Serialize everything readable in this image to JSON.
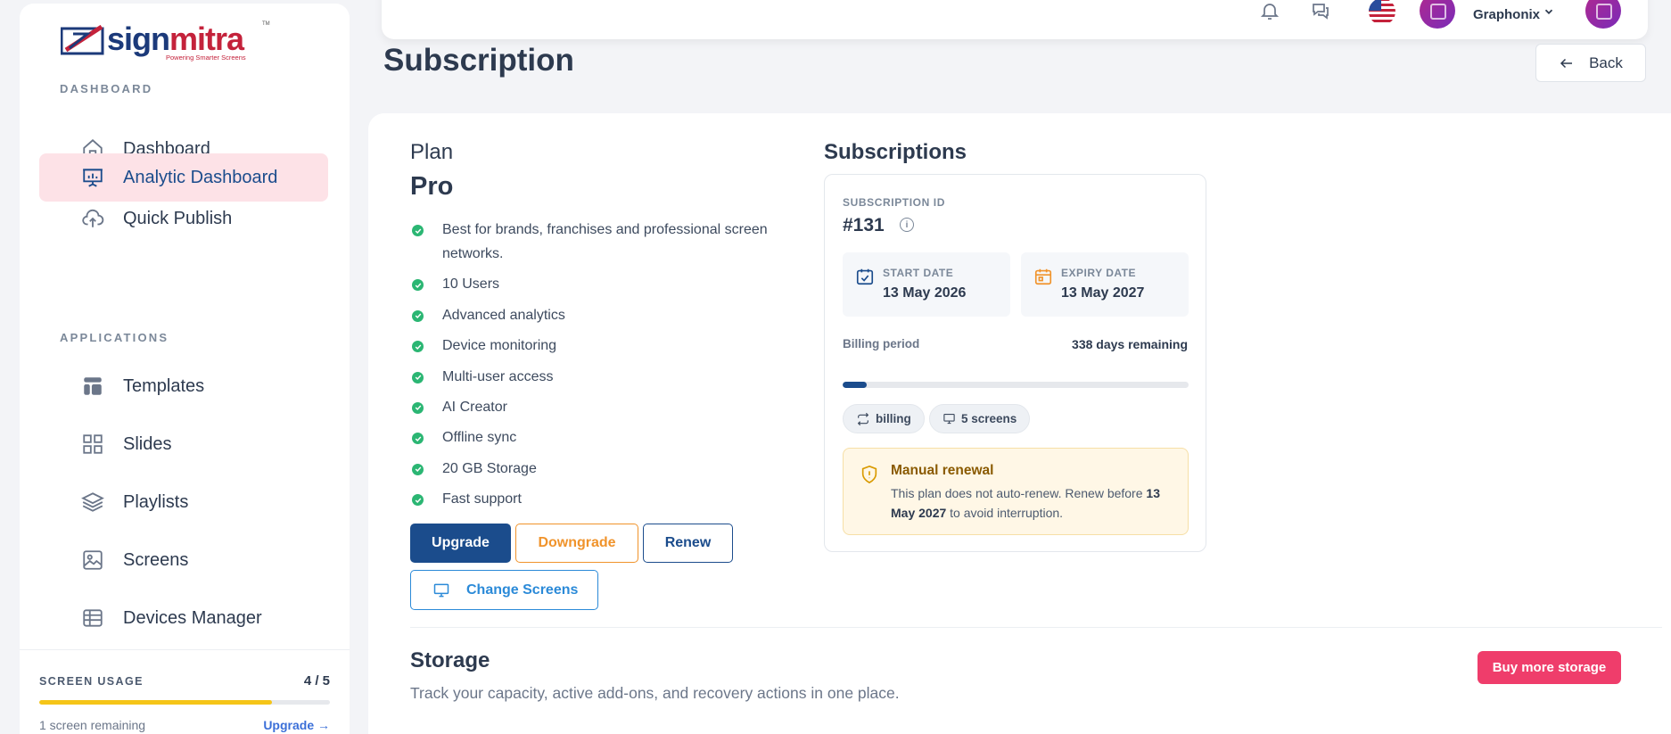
{
  "brand": {
    "logo_part1": "sign",
    "logo_part2": "mitra",
    "tagline": "Powering Smarter Screens",
    "tm": "TM"
  },
  "sidebar": {
    "section_dashboard": "DASHBOARD",
    "section_applications": "APPLICATIONS",
    "items": [
      {
        "label": "Dashboard",
        "icon": "home-icon",
        "active": false
      },
      {
        "label": "Analytic Dashboard",
        "icon": "presentation-chart-icon",
        "active": true
      },
      {
        "label": "Quick Publish",
        "icon": "cloud-upload-icon",
        "active": false
      },
      {
        "label": "Templates",
        "icon": "layout-icon",
        "active": false
      },
      {
        "label": "Slides",
        "icon": "grid-icon",
        "active": false
      },
      {
        "label": "Playlists",
        "icon": "layers-icon",
        "active": false
      },
      {
        "label": "Screens",
        "icon": "image-icon",
        "active": false
      },
      {
        "label": "Devices Manager",
        "icon": "table-icon",
        "active": false
      }
    ],
    "screen_usage": {
      "label": "SCREEN USAGE",
      "count": "4 / 5",
      "used": 4,
      "total": 5,
      "remaining": "1 screen remaining",
      "upgrade": "Upgrade →",
      "bar_color": "#f5c518"
    }
  },
  "header": {
    "user_name": "Graphonix",
    "icons": [
      "bell-icon",
      "chat-icon",
      "us-flag-icon",
      "avatar",
      "chevron-down-icon"
    ]
  },
  "page": {
    "title": "Subscription",
    "back_label": "Back"
  },
  "plan": {
    "heading": "Plan",
    "name": "Pro",
    "features": [
      "Best for brands, franchises and professional screen networks.",
      "10 Users",
      "Advanced analytics",
      "Device monitoring",
      "Multi-user access",
      "AI Creator",
      "Offline sync",
      "20 GB Storage",
      "Fast support"
    ],
    "buttons": {
      "upgrade": "Upgrade",
      "downgrade": "Downgrade",
      "renew": "Renew",
      "change_screens": "Change Screens"
    }
  },
  "subscriptions": {
    "heading": "Subscriptions",
    "id_label": "SUBSCRIPTION ID",
    "id_value": "#131",
    "start_label": "START DATE",
    "start_value": "13 May 2026",
    "expiry_label": "EXPIRY DATE",
    "expiry_value": "13 May 2027",
    "billing_label": "Billing period",
    "billing_remaining": "338 days remaining",
    "billing_progress": 0.07,
    "chips": {
      "billing": "billing",
      "screens": "5 screens"
    },
    "notice": {
      "title": "Manual renewal",
      "text_before": "This plan does not auto-renew. Renew before",
      "date": "13 May 2027",
      "text_after": "to avoid interruption."
    }
  },
  "storage": {
    "title": "Storage",
    "subtitle": "Track your capacity, active add-ons, and recovery actions in one place.",
    "buy_label": "Buy more storage"
  },
  "colors": {
    "primary": "#1b4c8c",
    "accent_pink": "#ef3d6b",
    "active_bg": "#fde2e7",
    "success": "#2bb673",
    "warning": "#f0932b"
  }
}
